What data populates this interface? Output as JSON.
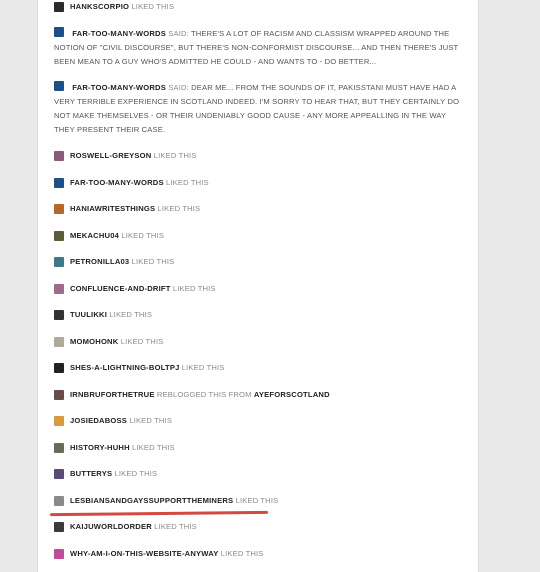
{
  "notes": [
    {
      "user": "HANKSCORPIO",
      "verb": "LIKED THIS",
      "avatar_color": "#2b2b2b"
    },
    {
      "user": "FAR-TOO-MANY-WORDS",
      "verb": "SAID:",
      "text": "THERE'S A LOT OF RACISM AND CLASSISM WRAPPED AROUND THE NOTION OF \"CIVIL DISCOURSE\", BUT THERE'S NON-CONFORMIST DISCOURSE... AND THEN THERE'S JUST BEEN MEAN TO A GUY WHO'S ADMITTED HE COULD - AND WANTS TO - DO BETTER...",
      "avatar_color": "#1f4f8a"
    },
    {
      "user": "FAR-TOO-MANY-WORDS",
      "verb": "SAID:",
      "text": "DEAR ME... FROM THE SOUNDS OF IT, PAKISSTANI MUST HAVE HAD A VERY TERRIBLE EXPERIENCE IN SCOTLAND INDEED. I'M SORRY TO HEAR THAT, BUT THEY CERTAINLY DO NOT MAKE THEMSELVES - OR THEIR UNDENIABLY GOOD CAUSE - ANY MORE APPEALLING IN THE WAY THEY PRESENT THEIR CASE.",
      "avatar_color": "#1f4f8a"
    },
    {
      "user": "ROSWELL-GREYSON",
      "verb": "LIKED THIS",
      "avatar_color": "#8a5a78"
    },
    {
      "user": "FAR-TOO-MANY-WORDS",
      "verb": "LIKED THIS",
      "avatar_color": "#1f4f8a"
    },
    {
      "user": "HANIAWRITESTHINGS",
      "verb": "LIKED THIS",
      "avatar_color": "#b4682a"
    },
    {
      "user": "MEKACHU04",
      "verb": "LIKED THIS",
      "avatar_color": "#5b5b3a"
    },
    {
      "user": "PETRONILLA03",
      "verb": "LIKED THIS",
      "avatar_color": "#3b7a86"
    },
    {
      "user": "CONFLUENCE-AND-DRIFT",
      "verb": "LIKED THIS",
      "avatar_color": "#a06a8a"
    },
    {
      "user": "TUULIKKI",
      "verb": "LIKED THIS",
      "avatar_color": "#333333"
    },
    {
      "user": "MOMOHONK",
      "verb": "LIKED THIS",
      "avatar_color": "#b0a898"
    },
    {
      "user": "SHES-A-LIGHTNING-BOLTPJ",
      "verb": "LIKED THIS",
      "avatar_color": "#222222"
    },
    {
      "user": "IRNBRUFORTHETRUE",
      "verb": "REBLOGGED THIS FROM",
      "user2": "AYEFORSCOTLAND",
      "avatar_color": "#6a4a4a"
    },
    {
      "user": "JOSIEDABOSS",
      "verb": "LIKED THIS",
      "avatar_color": "#d89a3a"
    },
    {
      "user": "HISTORY-HUHH",
      "verb": "LIKED THIS",
      "avatar_color": "#6a6a5a"
    },
    {
      "user": "BUTTERYS",
      "verb": "LIKED THIS",
      "avatar_color": "#5a4a7a"
    },
    {
      "user": "LESBIANSANDGAYSSUPPORTTHEMINERS",
      "verb": "LIKED THIS",
      "avatar_color": "#8a8a8a"
    },
    {
      "user": "KAIJUWORLDORDER",
      "verb": "LIKED THIS",
      "avatar_color": "#3a3a3a"
    },
    {
      "user": "WHY-AM-I-ON-THIS-WEBSITE-ANYWAY",
      "verb": "LIKED THIS",
      "avatar_color": "#c24a9a"
    }
  ],
  "highlight_color": "#d24a42"
}
